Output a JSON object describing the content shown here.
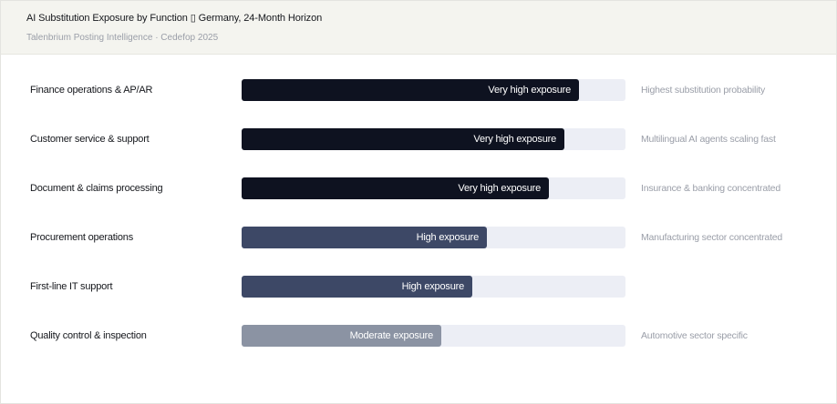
{
  "header": {
    "title": "AI Substitution Exposure by Function ▯ Germany, 24-Month Horizon",
    "subtitle": "Talenbrium Posting Intelligence · Cedefop 2025"
  },
  "colors": {
    "very_high": "#0e1220",
    "high": "#3d4866",
    "moderate": "#8b93a3",
    "track": "#eceef5"
  },
  "chart_data": {
    "type": "bar",
    "orientation": "horizontal",
    "categories": [
      "Finance operations & AP/AR",
      "Customer service & support",
      "Document & claims processing",
      "Procurement operations",
      "First-line IT support",
      "Quality control & inspection"
    ],
    "values": [
      0.88,
      0.84,
      0.8,
      0.64,
      0.6,
      0.52
    ],
    "levels": [
      "very_high",
      "very_high",
      "very_high",
      "high",
      "high",
      "moderate"
    ],
    "bar_labels": [
      "Very high exposure",
      "Very high exposure",
      "Very high exposure",
      "High exposure",
      "High exposure",
      "Moderate exposure"
    ],
    "notes": [
      "Highest substitution probability",
      "Multilingual AI agents scaling fast",
      "Insurance & banking concentrated",
      "Manufacturing sector concentrated",
      "",
      "Automotive sector specific"
    ],
    "xlim": [
      0,
      1
    ],
    "grid": false,
    "legend": "none"
  }
}
